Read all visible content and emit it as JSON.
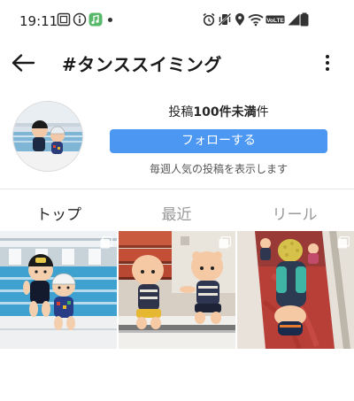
{
  "status_bar": {
    "time": "19:11",
    "left_icons": [
      "album-icon",
      "info-icon",
      "music-icon"
    ],
    "right_icons": [
      "alarm-icon",
      "vibrate-icon",
      "location-icon",
      "wifi-icon",
      "volte-icon",
      "signal-icon",
      "battery-icon"
    ],
    "volte_label": "VoLTE"
  },
  "header": {
    "title": "#タンススイミング"
  },
  "profile": {
    "post_prefix": "投稿",
    "post_count": "100件未満",
    "post_suffix": "件",
    "follow_label": "フォローする",
    "weekly_note": "毎週人気の投稿を表示します"
  },
  "tabs": [
    {
      "label": "トップ",
      "active": true
    },
    {
      "label": "最近",
      "active": false
    },
    {
      "label": "リール",
      "active": false
    }
  ],
  "colors": {
    "accent": "#4c97f1",
    "tab_active": "#262626",
    "tab_inactive": "#999999"
  }
}
